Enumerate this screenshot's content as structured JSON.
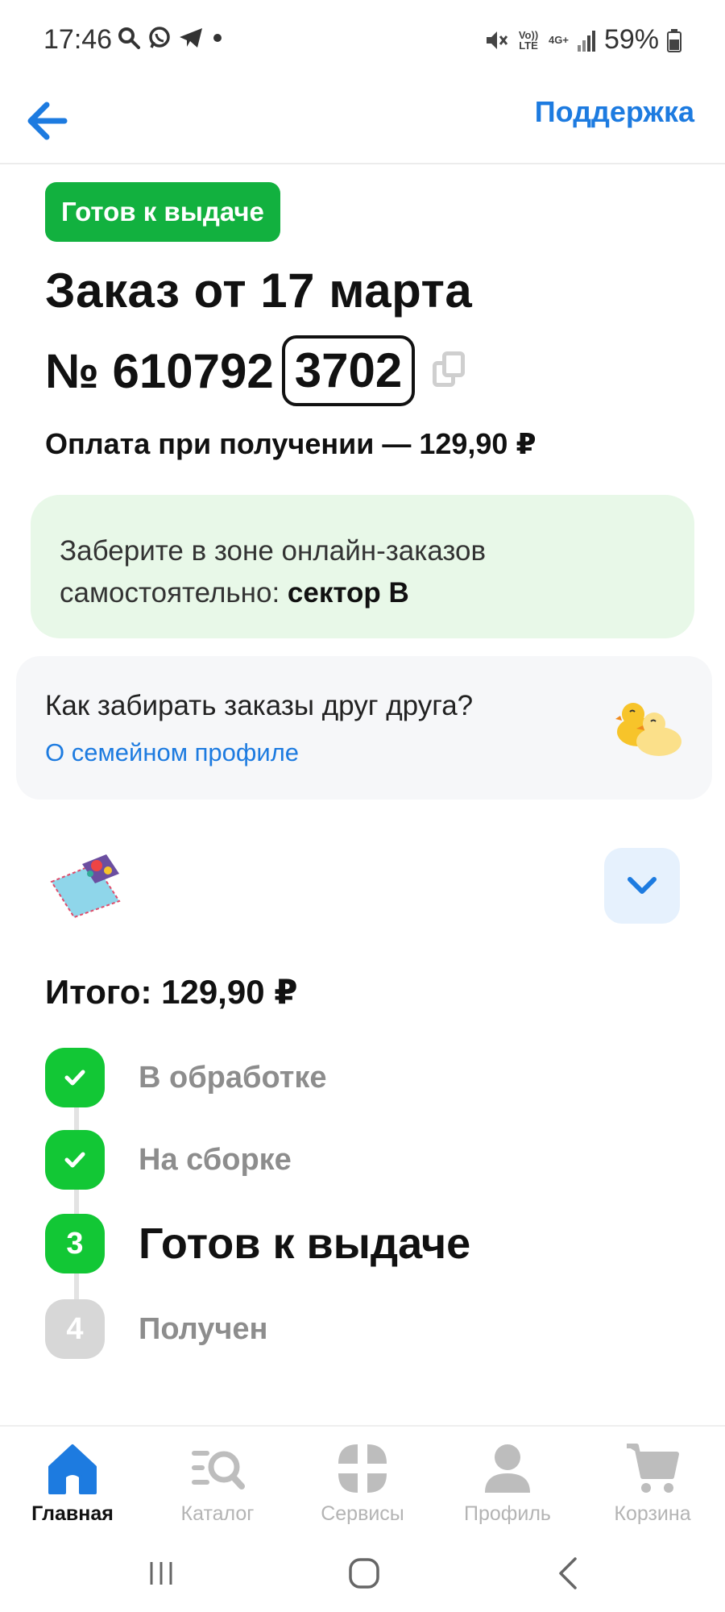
{
  "status_bar": {
    "time": "17:46",
    "battery": "59%",
    "volte": "Vo)) LTE",
    "network": "4G+",
    "left_icons": [
      "search-icon",
      "whatsapp-icon",
      "telegram-icon",
      "dot-icon"
    ],
    "right_icons": [
      "mute-icon",
      "volte-icon",
      "network-arrows-icon",
      "signal-icon",
      "battery-icon"
    ]
  },
  "header": {
    "support_label": "Поддержка",
    "back_icon": "arrow-left-icon"
  },
  "order": {
    "status_badge": "Готов к выдаче",
    "title": "Заказ от 17 марта",
    "number_prefix": "№ 610792",
    "number_suffix": "3702",
    "copy_icon": "copy-icon",
    "payment": "Оплата при получении — 129,90 ₽"
  },
  "pickup": {
    "text": "Заберите в зоне онлайн-заказов самостоятельно:",
    "sector": "сектор В"
  },
  "family": {
    "question": "Как забирать заказы друг друга?",
    "link": "О семейном профиле",
    "illustration": "ducks-icon"
  },
  "items": {
    "product_image": "baby-mat-image",
    "expand_icon": "chevron-down-icon"
  },
  "total": "Итого: 129,90 ₽",
  "steps": [
    {
      "marker": "✓",
      "label": "В обработке",
      "state": "done"
    },
    {
      "marker": "✓",
      "label": "На сборке",
      "state": "done"
    },
    {
      "marker": "3",
      "label": "Готов к выдаче",
      "state": "current"
    },
    {
      "marker": "4",
      "label": "Получен",
      "state": "pending"
    }
  ],
  "bottom_nav": [
    {
      "label": "Главная",
      "icon": "home-icon",
      "active": true
    },
    {
      "label": "Каталог",
      "icon": "catalog-search-icon",
      "active": false
    },
    {
      "label": "Сервисы",
      "icon": "services-grid-icon",
      "active": false
    },
    {
      "label": "Профиль",
      "icon": "profile-icon",
      "active": false
    },
    {
      "label": "Корзина",
      "icon": "cart-icon",
      "active": false
    }
  ],
  "colors": {
    "accent_blue": "#1d7be0",
    "success_green": "#12b13f",
    "step_green": "#12c735",
    "pickup_bg": "#e8f8e8"
  }
}
